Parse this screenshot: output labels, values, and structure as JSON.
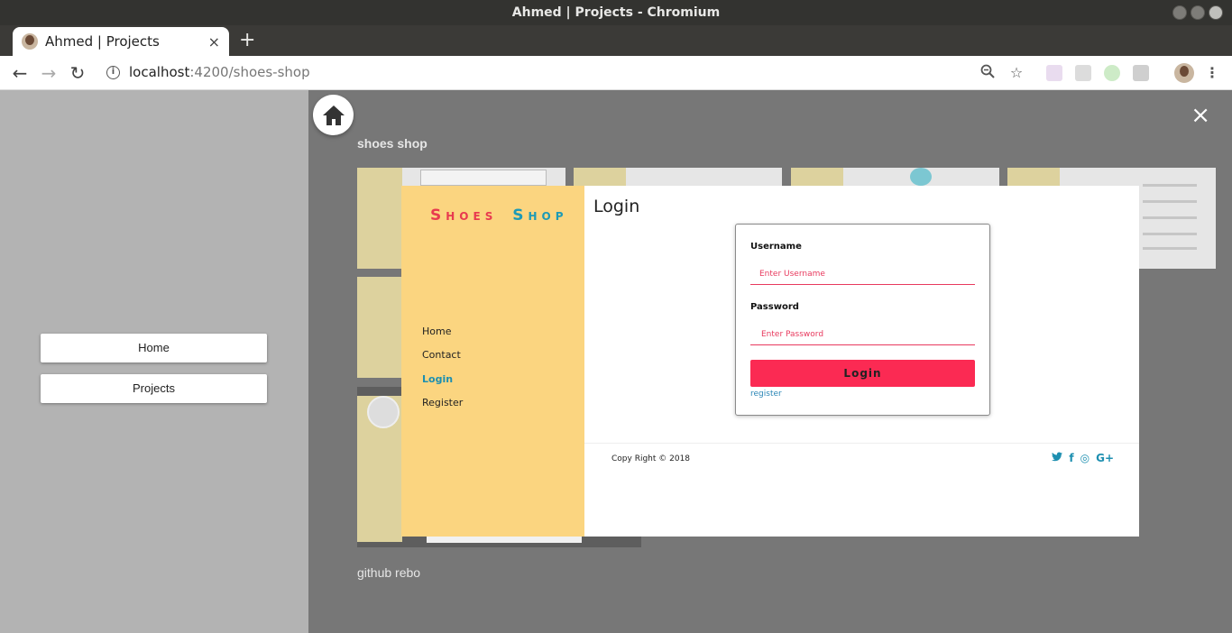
{
  "window": {
    "title": "Ahmed | Projects - Chromium"
  },
  "tab": {
    "title": "Ahmed | Projects",
    "close": "×"
  },
  "newtab": "+",
  "address": {
    "host": "localhost",
    "path": ":4200/shoes-shop"
  },
  "sidebar": {
    "items": [
      {
        "label": "Home"
      },
      {
        "label": "Projects"
      }
    ]
  },
  "project": {
    "title": "shoes shop",
    "link": "github rebo",
    "close": "×"
  },
  "modal": {
    "brand": {
      "first_cap": "S",
      "first_rest": "HOES",
      "second_cap": "S",
      "second_rest": "HOP"
    },
    "nav": [
      {
        "label": "Home"
      },
      {
        "label": "Contact"
      },
      {
        "label": "Login"
      },
      {
        "label": "Register"
      }
    ],
    "heading": "Login",
    "form": {
      "username_label": "Username",
      "username_placeholder": "Enter Username",
      "password_label": "Password",
      "password_placeholder": "Enter Password",
      "submit": "Login",
      "register": "register"
    },
    "footer": {
      "copyright": "Copy Right © 2018"
    },
    "socials": [
      {
        "icon": "twitter-icon",
        "glyph": "🐦"
      },
      {
        "icon": "facebook-icon",
        "glyph": "f"
      },
      {
        "icon": "github-icon",
        "glyph": "◎"
      },
      {
        "icon": "google-plus-icon",
        "glyph": "G+"
      }
    ]
  },
  "colors": {
    "accent": "#fb2a53",
    "sidebar_yellow": "#fbd580",
    "link_blue": "#1d8fb0"
  }
}
